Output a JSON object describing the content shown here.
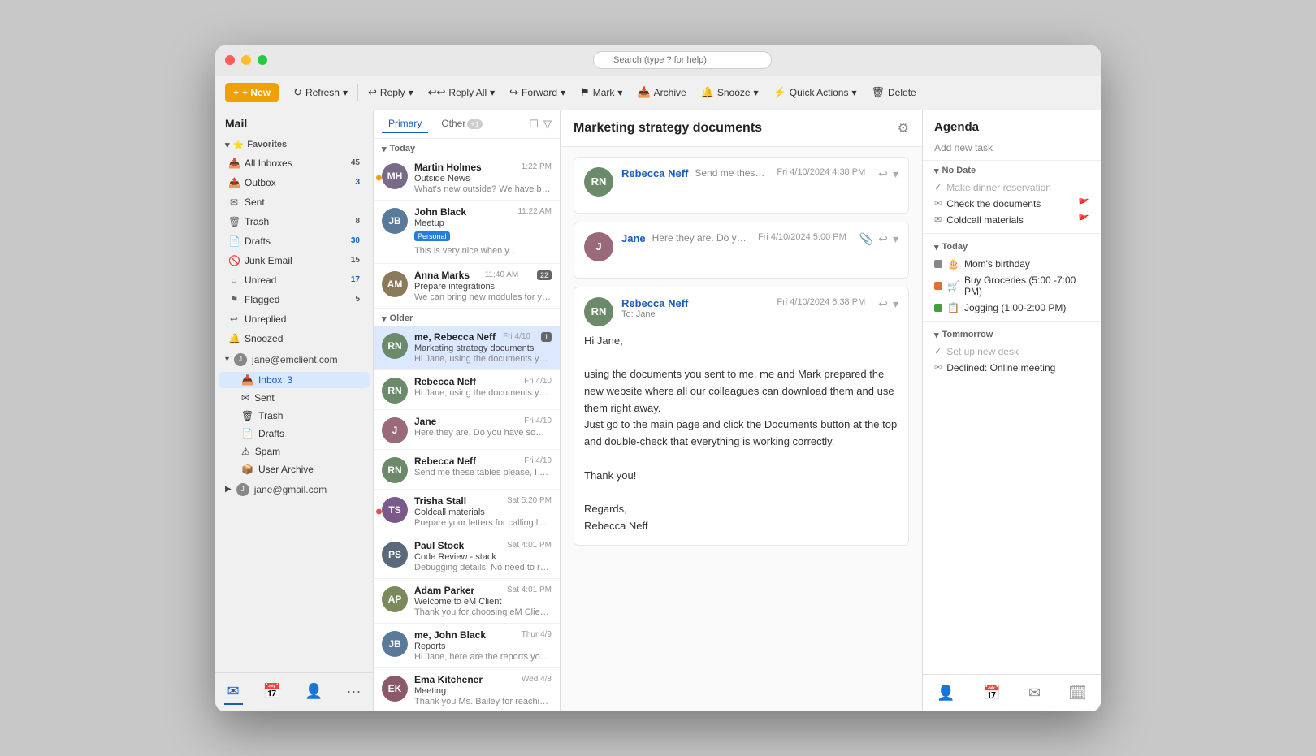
{
  "window": {
    "title": "Mail"
  },
  "search": {
    "placeholder": "Search (type ? for help)"
  },
  "toolbar": {
    "new_label": "+ New",
    "refresh_label": "Refresh",
    "reply_label": "Reply",
    "reply_all_label": "Reply All",
    "forward_label": "Forward",
    "mark_label": "Mark",
    "archive_label": "Archive",
    "snooze_label": "Snooze",
    "quick_actions_label": "Quick Actions",
    "delete_label": "Delete"
  },
  "sidebar": {
    "title": "Mail",
    "favorites_label": "Favorites",
    "all_inboxes": {
      "label": "All Inboxes",
      "badge": "45"
    },
    "outbox": {
      "label": "Outbox",
      "badge": "3"
    },
    "sent": {
      "label": "Sent",
      "badge": ""
    },
    "trash": {
      "label": "Trash",
      "badge": "8"
    },
    "drafts": {
      "label": "Drafts",
      "badge": "30"
    },
    "junk": {
      "label": "Junk Email",
      "badge": "15"
    },
    "unread": {
      "label": "Unread",
      "badge": "17"
    },
    "flagged": {
      "label": "Flagged",
      "badge": "5"
    },
    "unreplied": {
      "label": "Unreplied",
      "badge": ""
    },
    "snoozed": {
      "label": "Snoozed",
      "badge": ""
    },
    "account1": {
      "email": "jane@emclient.com",
      "inbox_label": "Inbox",
      "inbox_badge": "3",
      "sent_label": "Sent",
      "trash_label": "Trash",
      "drafts_label": "Drafts",
      "spam_label": "Spam",
      "archive_label": "User Archive"
    },
    "account2": {
      "email": "jane@gmail.com"
    }
  },
  "email_list": {
    "tab_primary": "Primary",
    "tab_other": "Other",
    "other_badge": "+1",
    "group_today": "Today",
    "group_older": "Older",
    "emails_today": [
      {
        "from": "Martin Holmes",
        "subject": "Outside News",
        "preview": "What's new outside? We have been...",
        "time": "1:22 PM",
        "avatar_initials": "MH",
        "avatar_color": "#7a6a8a",
        "unread": true
      },
      {
        "from": "John Black",
        "subject": "Meetup",
        "preview": "This is very nice when y...",
        "time": "11:22 AM",
        "avatar_initials": "JB",
        "avatar_color": "#5a7a9a",
        "tag": "Personal"
      },
      {
        "from": "Anna Marks",
        "subject": "Prepare integrations",
        "preview": "We can bring new modules for you...",
        "time": "11:40 AM",
        "avatar_initials": "AM",
        "avatar_color": "#8a7a5a",
        "count": "22"
      }
    ],
    "emails_older": [
      {
        "from": "me, Rebecca Neff",
        "subject": "Marketing strategy documents",
        "preview": "Hi Jane, using the documents you se...",
        "time": "Fri 4/10",
        "avatar_initials": "RN",
        "avatar_color": "#6a8a6a",
        "selected": true,
        "count": "1"
      },
      {
        "from": "Rebecca Neff",
        "subject": "",
        "preview": "Hi Jane, using the documents you se...",
        "time": "Fri 4/10",
        "avatar_initials": "RN",
        "avatar_color": "#6a8a6a"
      },
      {
        "from": "Jane",
        "subject": "",
        "preview": "Here they are. Do you have some adv...",
        "time": "Fri 4/10",
        "avatar_initials": "J",
        "avatar_color": "#9a6a7a"
      },
      {
        "from": "Rebecca Neff",
        "subject": "",
        "preview": "Send me these tables please, I need t...",
        "time": "Fri 4/10",
        "avatar_initials": "RN",
        "avatar_color": "#6a8a6a"
      },
      {
        "from": "Trisha Stall",
        "subject": "Coldcall materials",
        "preview": "Prepare your letters for calling later t...",
        "time": "Sat 5:20 PM",
        "avatar_initials": "TS",
        "avatar_color": "#7a5a8a",
        "flagged": true
      },
      {
        "from": "Paul Stock",
        "subject": "Code Review - stack",
        "preview": "Debugging details. No need to reply.",
        "time": "Sat 4:01 PM",
        "avatar_initials": "PS",
        "avatar_color": "#5a6a7a"
      },
      {
        "from": "Adam Parker",
        "subject": "Welcome to eM Client",
        "preview": "Thank you for choosing eM Client. It...",
        "time": "Sat 4:01 PM",
        "avatar_initials": "AP",
        "avatar_color": "#7a8a5a"
      },
      {
        "from": "me, John Black",
        "subject": "Reports",
        "preview": "Hi Jane, here are the reports you ask...",
        "time": "Thur 4/9",
        "avatar_initials": "JB",
        "avatar_color": "#5a7a9a"
      },
      {
        "from": "Ema Kitchener",
        "subject": "Meeting",
        "preview": "Thank you Ms. Bailey for reaching ou...",
        "time": "Wed 4/8",
        "avatar_initials": "EK",
        "avatar_color": "#8a5a6a",
        "is_purple": true
      }
    ]
  },
  "email_pane": {
    "subject": "Marketing strategy documents",
    "messages": [
      {
        "sender": "Rebecca Neff",
        "to": null,
        "date": "Fri 4/10/2024 4:38 PM",
        "preview": "Send me these tables please, I need to cooperate with Mark on this website project...",
        "collapsed": true,
        "avatar_initials": "RN",
        "avatar_color": "#6a8a6a"
      },
      {
        "sender": "Jane",
        "to": null,
        "date": "Fri 4/10/2024 5:00 PM",
        "preview": "Here they are. Do you have some advice on how to access the documents once th...",
        "collapsed": true,
        "avatar_initials": "J",
        "avatar_color": "#9a6a7a"
      },
      {
        "sender": "Rebecca Neff",
        "to": "Jane",
        "date": "Fri 4/10/2024 6:38 PM",
        "collapsed": false,
        "avatar_initials": "RN",
        "avatar_color": "#6a8a6a",
        "body_lines": [
          "Hi Jane,",
          "",
          "using the documents you sent to me, me and Mark prepared the new website where all our colleagues can download them and use them right away.",
          "Just go to the main page and click the Documents button at the top and double-check that everything is working correctly.",
          "",
          "Thank you!",
          "",
          "Regards,",
          "Rebecca Neff"
        ]
      }
    ]
  },
  "agenda": {
    "title": "Agenda",
    "add_task": "Add new task",
    "no_date_label": "No Date",
    "tasks_no_date": [
      {
        "label": "Make dinner reservation",
        "done": true,
        "icon": "✓"
      },
      {
        "label": "Check the documents",
        "done": false,
        "icon": "✉",
        "flagged": true
      },
      {
        "label": "Coldcall materials",
        "done": false,
        "icon": "✉",
        "flagged": true
      }
    ],
    "today_label": "Today",
    "events_today": [
      {
        "label": "Mom's birthday",
        "color": "#888888",
        "icon": "🎂"
      },
      {
        "label": "Buy Groceries (5:00 -7:00 PM)",
        "color": "#e07030",
        "icon": "🛒"
      },
      {
        "label": "Jogging (1:00-2:00 PM)",
        "color": "#40a040",
        "icon": "📋"
      }
    ],
    "tomorrow_label": "Tommorrow",
    "tasks_tomorrow": [
      {
        "label": "Set up new desk",
        "done": true,
        "icon": "✓"
      },
      {
        "label": "Declined: Online meeting",
        "done": false,
        "icon": "✉"
      }
    ]
  }
}
